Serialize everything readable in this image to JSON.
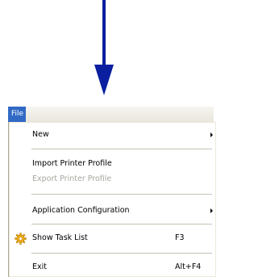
{
  "menu_bar": {
    "file_label": "File"
  },
  "menu": {
    "new_label": "New",
    "import_label": "Import Printer Profile",
    "export_label": "Export Printer Profile",
    "app_config_label": "Application Configuration",
    "task_list_label": "Show Task List",
    "task_list_shortcut": "F3",
    "exit_label": "Exit",
    "exit_shortcut": "Alt+F4"
  },
  "icons": {
    "arrow": "down-arrow",
    "task_list": "gear-icon",
    "submenu": "chevron-right-icon"
  },
  "colors": {
    "arrow": "#0a1fa0",
    "highlight": "#316ac5",
    "disabled_text": "#a7a6a0",
    "gear": "#f2b31c"
  }
}
